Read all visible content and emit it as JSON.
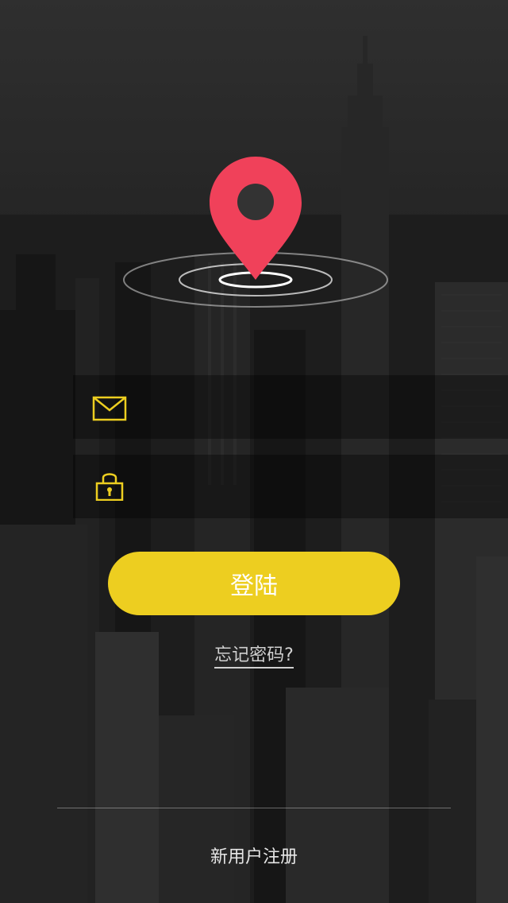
{
  "colors": {
    "accent": "#EDCE20",
    "pin": "#F0415A",
    "text_light": "#FFFFFF",
    "text_muted": "#D0D0D0"
  },
  "icons": {
    "logo": "location-pin-icon",
    "email": "mail-icon",
    "password": "lock-icon"
  },
  "form": {
    "email_value": "",
    "password_value": "",
    "login_label": "登陆",
    "forgot_label": "忘记密码?"
  },
  "footer": {
    "register_label": "新用户注册"
  }
}
